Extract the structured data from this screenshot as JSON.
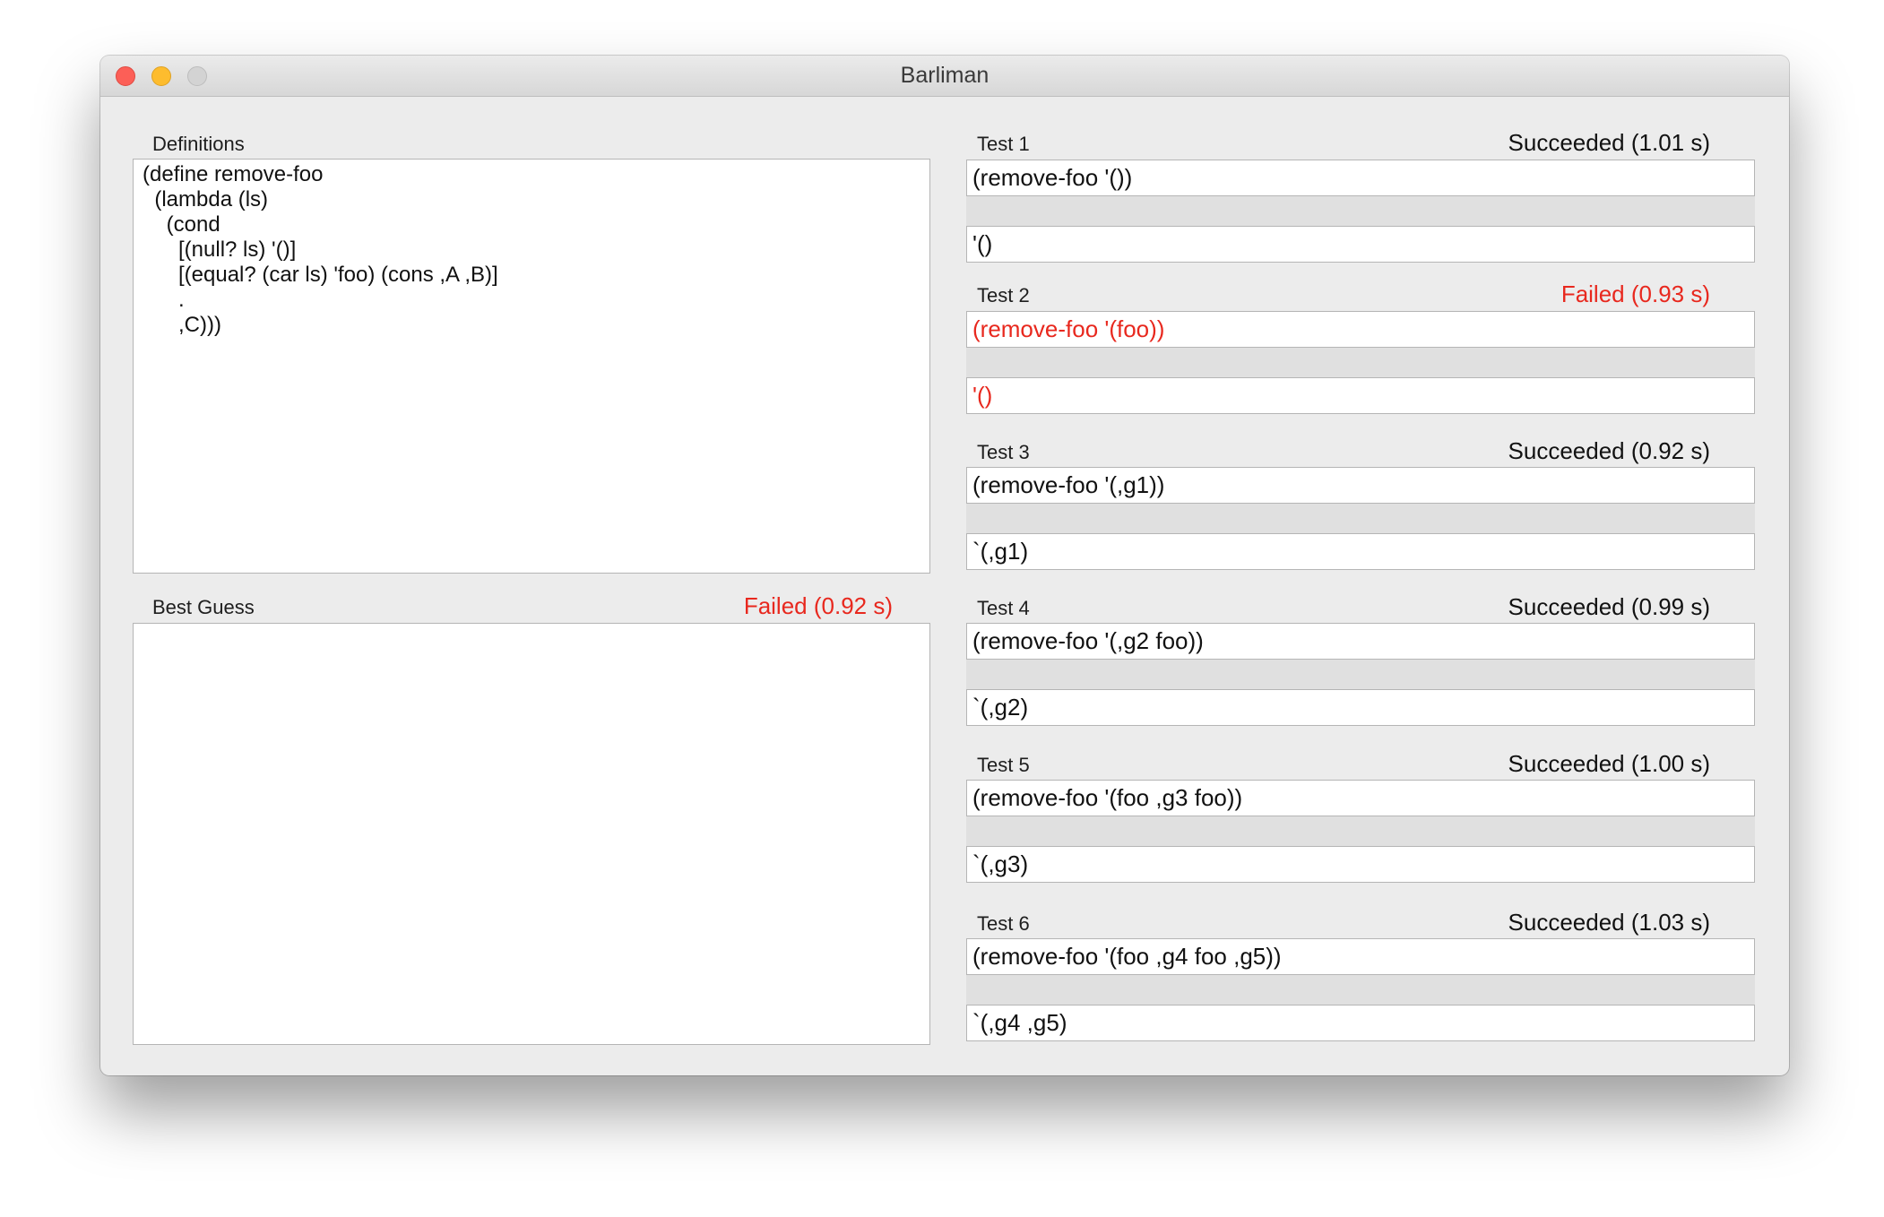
{
  "window": {
    "title": "Barliman"
  },
  "definitions": {
    "label": "Definitions",
    "code": "(define remove-foo\n  (lambda (ls)\n    (cond\n      [(null? ls) '()]\n      [(equal? (car ls) 'foo) (cons ,A ,B)]\n      .\n      ,C)))"
  },
  "best_guess": {
    "label": "Best Guess",
    "status": "Failed (0.92 s)",
    "status_kind": "failed",
    "code": ""
  },
  "tests": [
    {
      "label": "Test 1",
      "status": "Succeeded (1.01 s)",
      "status_kind": "succeeded",
      "input": "(remove-foo '())",
      "expected": "'()"
    },
    {
      "label": "Test 2",
      "status": "Failed (0.93 s)",
      "status_kind": "failed",
      "input": "(remove-foo '(foo))",
      "expected": "'()"
    },
    {
      "label": "Test 3",
      "status": "Succeeded (0.92 s)",
      "status_kind": "succeeded",
      "input": "(remove-foo '(,g1))",
      "expected": "`(,g1)"
    },
    {
      "label": "Test 4",
      "status": "Succeeded (0.99 s)",
      "status_kind": "succeeded",
      "input": "(remove-foo '(,g2 foo))",
      "expected": "`(,g2)"
    },
    {
      "label": "Test 5",
      "status": "Succeeded (1.00 s)",
      "status_kind": "succeeded",
      "input": "(remove-foo '(foo ,g3 foo))",
      "expected": "`(,g3)"
    },
    {
      "label": "Test 6",
      "status": "Succeeded (1.03 s)",
      "status_kind": "succeeded",
      "input": "(remove-foo '(foo ,g4 foo ,g5))",
      "expected": "`(,g4 ,g5)"
    }
  ],
  "colors": {
    "failed": "#e8281e",
    "succeeded": "#111111",
    "close_button": "#fc5f57",
    "minimize_button": "#fdbc2e",
    "zoom_button": "#d3d3d3"
  }
}
